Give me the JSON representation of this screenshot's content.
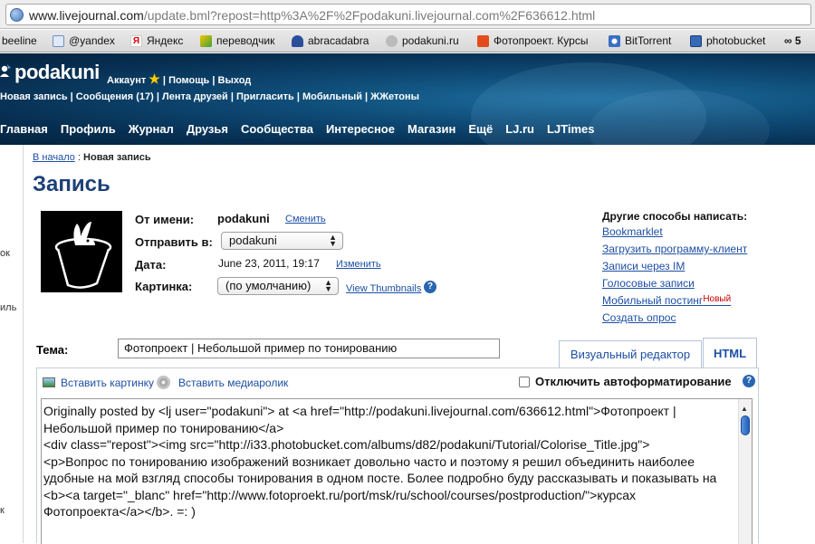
{
  "browser": {
    "url_host": "www.livejournal.com",
    "url_path": "/update.bml?repost=http%3A%2F%2Fpodakuni.livejournal.com%2F636612.html",
    "bookmarks": [
      "beeline",
      "@yandex",
      "Яндекс",
      "переводчик",
      "abracadabra",
      "podakuni.ru",
      "Фотопроект. Курсы",
      "BitTorrent",
      "photobucket",
      "∞ 5"
    ]
  },
  "header": {
    "username": "podakuni",
    "account_links": [
      "Аккаунт",
      "Помощь",
      "Выход"
    ],
    "subnav": "Новая запись | Сообщения (17) | Лента друзей | Пригласить | Мобильный | ЖЖетоны",
    "mainnav": [
      "Главная",
      "Профиль",
      "Журнал",
      "Друзья",
      "Сообщества",
      "Интересное",
      "Магазин",
      "Ещё",
      "LJ.ru",
      "LJTimes"
    ]
  },
  "left_edge": [
    "ок",
    "иль",
    "к"
  ],
  "breadcrumb": {
    "home": "В начало",
    "separator": " : ",
    "current": "Новая запись"
  },
  "page_title": "Запись",
  "form": {
    "from_label": "От имени:",
    "from_value": "podakuni",
    "change_link": "Сменить",
    "post_to_label": "Отправить в:",
    "post_to_value": "podakuni",
    "date_label": "Дата:",
    "date_value": "June 23, 2011, 19:17",
    "date_change_link": "Изменить",
    "picture_label": "Картинка:",
    "picture_value": "(по умолчанию)",
    "view_thumbs": "View Thumbnails",
    "subject_label": "Тема:",
    "subject_value": "Фотопроект | Небольшой пример по тонированию"
  },
  "other_ways": {
    "heading": "Другие способы написать:",
    "items": [
      "Bookmarklet",
      "Загрузить программу-клиент",
      "Записи через IM",
      "Голосовые записи",
      "Мобильный постинг",
      "Создать опрос"
    ],
    "new_badge": "Новый"
  },
  "editor": {
    "tab_visual": "Визуальный редактор",
    "tab_html": "HTML",
    "insert_image": "Вставить картинку",
    "insert_media": "Вставить медиаролик",
    "disable_autoformat": "Отключить автоформатирование",
    "autoformat_checked": false,
    "body": "Originally posted by <lj user=\"podakuni\"> at <a href=\"http://podakuni.livejournal.com/636612.html\">Фотопроект | Небольшой пример по тонированию</a>\n<div class=\"repost\"><img src=\"http://i33.photobucket.com/albums/d82/podakuni/Tutorial/Colorise_Title.jpg\">\n<p>Вопрос по тонированию изображений возникает довольно часто и поэтому я решил объединить наиболее удобные на мой взгляд способы тонирования в одном посте. Более подробно буду рассказывать и показывать на <b><a target=\"_blanc\" href=\"http://www.fotoproekt.ru/port/msk/ru/school/courses/postproduction/\">курсах Фотопроекта</a></b>. =: )"
  },
  "colors": {
    "link": "#1d4fa3",
    "title": "#1d4177",
    "banner": "#0e4a75",
    "new_badge": "#cc0000"
  }
}
